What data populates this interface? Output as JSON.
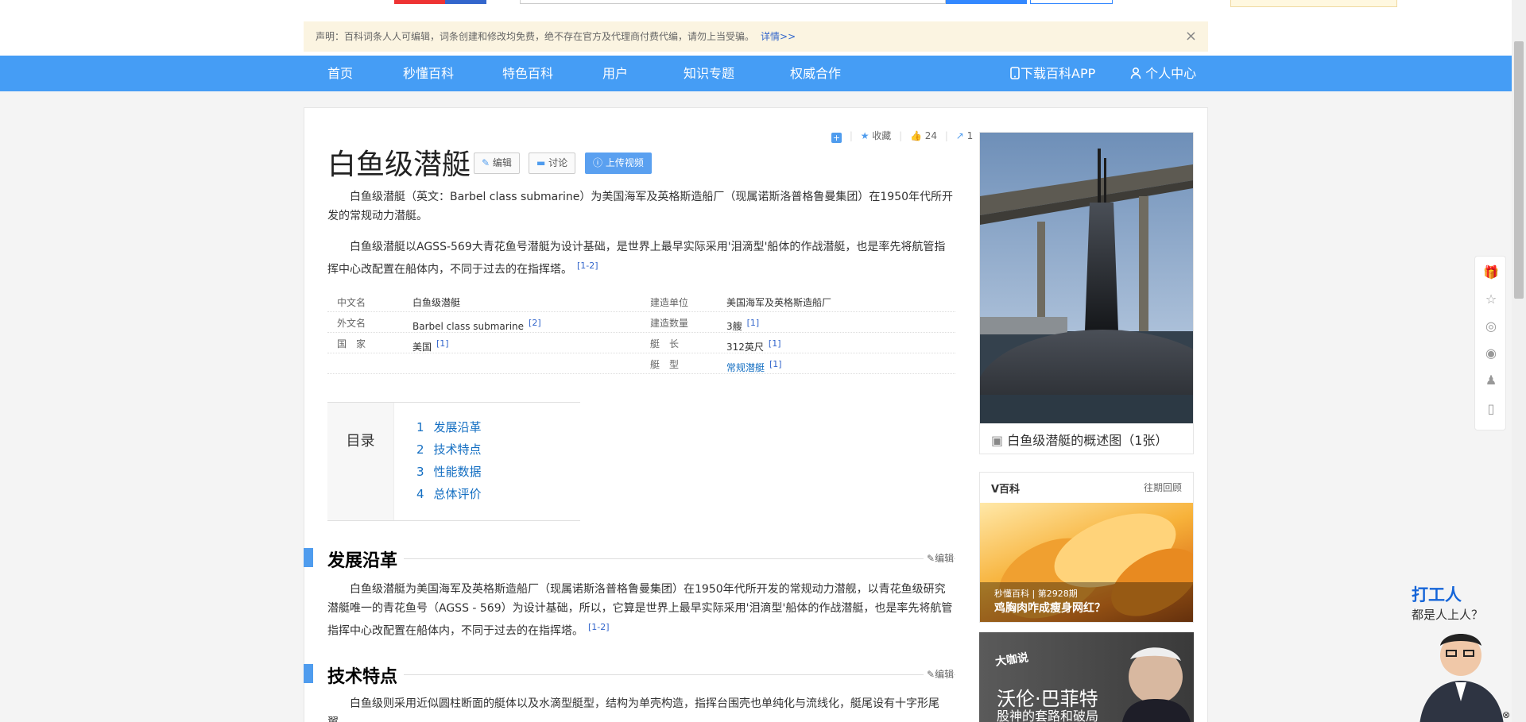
{
  "notice": {
    "text": "声明：百科词条人人可编辑，词条创建和修改均免费，绝不存在官方及代理商付费代编，请勿上当受骗。",
    "link": "详情>>",
    "close": "×"
  },
  "nav": {
    "items": [
      "首页",
      "秒懂百科",
      "特色百科",
      "用户",
      "知识专题",
      "权威合作"
    ],
    "app": "下载百科APP",
    "user": "个人中心"
  },
  "article": {
    "title": "白鱼级潜艇",
    "edit_btn": "编辑",
    "discuss_btn": "讨论",
    "upload_btn": "上传视频",
    "tools": {
      "fav": "收藏",
      "likes": "24",
      "shares": "1"
    },
    "intro1": "白鱼级潜艇（英文：Barbel class submarine）为美国海军及英格斯造船厂（现属诺斯洛普格鲁曼集团）在1950年代所开发的常规动力潜艇。",
    "intro2": "白鱼级潜艇以AGSS-569大青花鱼号潜艇为设计基础，是世界上最早实际采用'泪滴型'船体的作战潜艇，也是率先将航管指挥中心改配置在船体内，不同于过去的在指挥塔。",
    "intro2_ref": "[1-2]"
  },
  "infobox": [
    {
      "k1": "中文名",
      "v1": "白鱼级潜艇",
      "r1": "",
      "k2": "建造单位",
      "v2": "美国海军及英格斯造船厂",
      "r2": ""
    },
    {
      "k1": "外文名",
      "v1": "Barbel class submarine",
      "r1": "[2]",
      "k2": "建造数量",
      "v2": "3艘",
      "r2": "[1]"
    },
    {
      "k1": "国　家",
      "v1": "美国",
      "r1": "[1]",
      "k2": "艇　长",
      "v2": "312英尺",
      "r2": "[1]"
    },
    {
      "k1": "",
      "v1": "",
      "r1": "",
      "k2": "艇　型",
      "v2": "常规潜艇",
      "r2": "[1]"
    }
  ],
  "toc": {
    "label": "目录",
    "entries": [
      {
        "n": "1",
        "t": "发展沿革"
      },
      {
        "n": "2",
        "t": "技术特点"
      },
      {
        "n": "3",
        "t": "性能数据"
      },
      {
        "n": "4",
        "t": "总体评价"
      }
    ]
  },
  "sections": [
    {
      "title": "发展沿革",
      "edit": "编辑",
      "text": "白鱼级潜艇为美国海军及英格斯造船厂（现属诺斯洛普格鲁曼集团）在1950年代所开发的常规动力潜舰，以青花鱼级研究潜艇唯一的青花鱼号（AGSS - 569）为设计基础，所以，它算是世界上最早实际采用'泪滴型'船体的作战潜艇，也是率先将航管指挥中心改配置在船体内，不同于过去的在指挥塔。",
      "ref": "[1-2]"
    },
    {
      "title": "技术特点",
      "edit": "编辑",
      "text": "白鱼级则采用近似圆柱断面的艇体以及水滴型艇型，结构为单壳构造，指挥台围壳也单纯化与流线化，艇尾设有十字形尾翼。"
    }
  ],
  "album": {
    "caption": "白鱼级潜艇的概述图（1张）"
  },
  "vbaike": {
    "title": "V百科",
    "more": "往期回顾",
    "meta": "秒懂百科 | 第2928期",
    "video_title": "鸡胸肉咋成瘦身网红？"
  },
  "ad": {
    "brand": "大咖说",
    "name": "沃伦·巴菲特",
    "sub": "股神的套路和破局"
  },
  "float_ad": {
    "line1": "打工人",
    "line2": "都是人上人？"
  },
  "colors": {
    "nav": "#459df5",
    "link": "#136ec2",
    "accent": "#4f9cee"
  }
}
